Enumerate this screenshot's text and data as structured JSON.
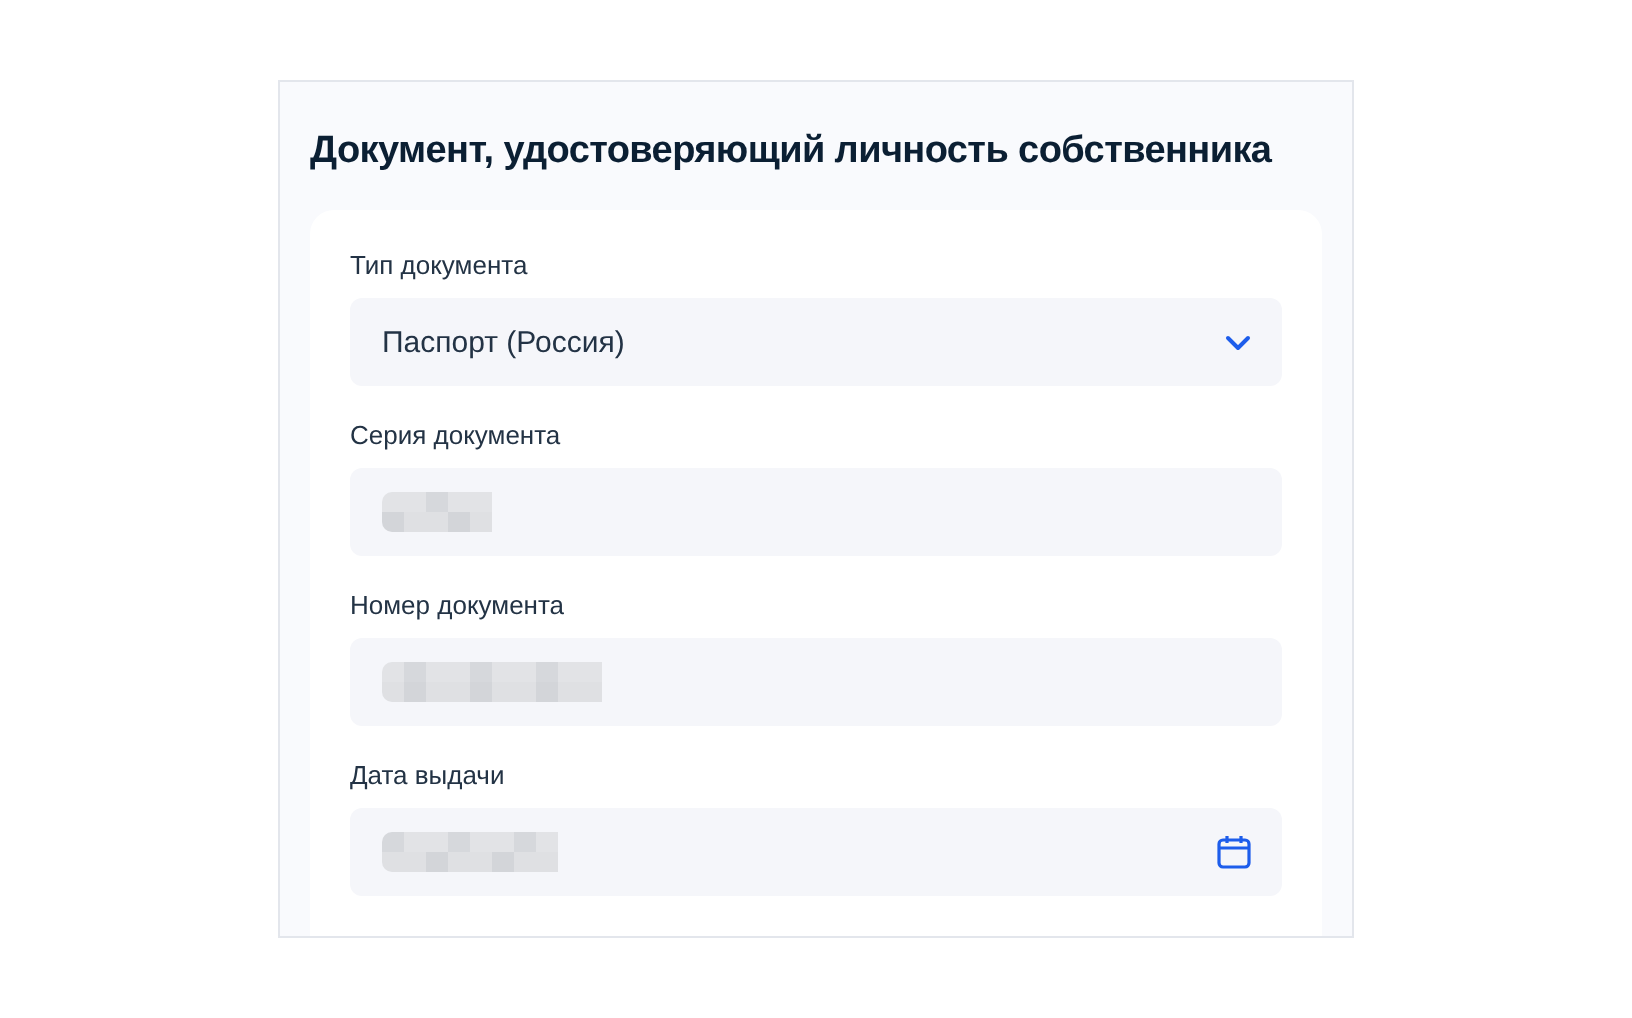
{
  "section": {
    "title": "Документ, удостоверяющий личность собственника"
  },
  "fields": [
    {
      "label": "Тип документа",
      "kind": "select",
      "value": "Паспорт (Россия)"
    },
    {
      "label": "Серия документа",
      "kind": "text",
      "redacted": true
    },
    {
      "label": "Номер документа",
      "kind": "text",
      "redacted": true
    },
    {
      "label": "Дата выдачи",
      "kind": "date",
      "redacted": true
    }
  ]
}
